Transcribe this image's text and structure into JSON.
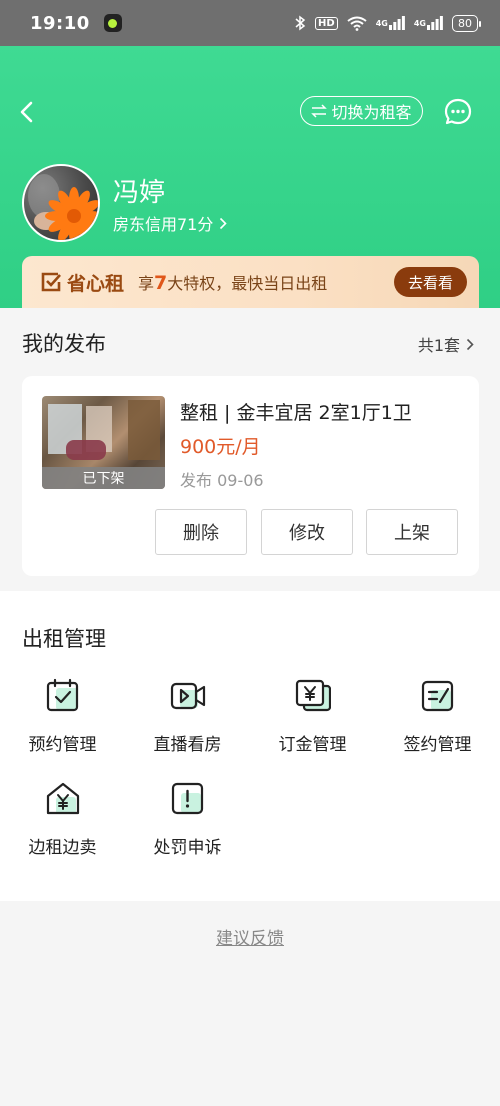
{
  "status": {
    "time": "19:10",
    "hd_label": "HD",
    "net1": "4G",
    "net2": "4G",
    "battery": "80"
  },
  "header": {
    "switch_label": "切换为租客",
    "user_name": "冯婷",
    "credit": "房东信用71分"
  },
  "promo": {
    "logo_text": "省心租",
    "text_prefix": "享",
    "text_num": "7",
    "text_suffix": "大特权，最快当日出租",
    "button": "去看看"
  },
  "publications": {
    "title": "我的发布",
    "total": "共1套",
    "card": {
      "status_label": "已下架",
      "title": "整租 | 金丰宜居 2室1厅1卫",
      "price": "900元/月",
      "date": "发布 09-06",
      "buttons": [
        "删除",
        "修改",
        "上架"
      ]
    }
  },
  "management": {
    "title": "出租管理",
    "items": [
      {
        "label": "预约管理",
        "icon": "calendar-check-icon"
      },
      {
        "label": "直播看房",
        "icon": "video-camera-icon"
      },
      {
        "label": "订金管理",
        "icon": "yen-cards-icon"
      },
      {
        "label": "签约管理",
        "icon": "contract-edit-icon"
      },
      {
        "label": "边租边卖",
        "icon": "house-yen-icon"
      },
      {
        "label": "处罚申诉",
        "icon": "exclamation-icon"
      }
    ]
  },
  "footer": {
    "feedback": "建议反馈"
  },
  "colors": {
    "header_green": "#3fda93",
    "accent_orange": "#e15a2a",
    "promo_button": "#8a3b0d",
    "icon_tint": "#c9f2e0"
  }
}
